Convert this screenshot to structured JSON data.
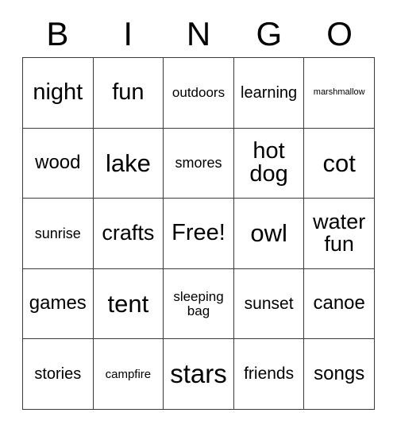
{
  "card": {
    "title": "BINGO",
    "header_letters": [
      "B",
      "I",
      "N",
      "G",
      "O"
    ],
    "free_space_label": "Free!",
    "text_color": "#000000",
    "border_color": "#3a3a3a",
    "background_color": "#ffffff",
    "rows": 5,
    "columns": 5,
    "cells": [
      [
        {
          "text": "night",
          "size": "fs-xxl"
        },
        {
          "text": "fun",
          "size": "fs-xxl"
        },
        {
          "text": "outdoors",
          "size": "fs-s"
        },
        {
          "text": "learning",
          "size": "fs-m"
        },
        {
          "text": "marshmallow",
          "size": "fs-xxs"
        }
      ],
      [
        {
          "text": "wood",
          "size": "fs-l"
        },
        {
          "text": "lake",
          "size": "fs-3xl"
        },
        {
          "text": "smores",
          "size": "fs-sm"
        },
        {
          "text": "hot dog",
          "size": "fs-xxl"
        },
        {
          "text": "cot",
          "size": "fs-3xl"
        }
      ],
      [
        {
          "text": "sunrise",
          "size": "fs-sm"
        },
        {
          "text": "crafts",
          "size": "fs-xl"
        },
        {
          "text": "Free!",
          "size": "fs-xxl"
        },
        {
          "text": "owl",
          "size": "fs-3xl"
        },
        {
          "text": "water fun",
          "size": "fs-xl"
        }
      ],
      [
        {
          "text": "games",
          "size": "fs-l"
        },
        {
          "text": "tent",
          "size": "fs-3xl"
        },
        {
          "text": "sleeping bag",
          "size": "fs-s"
        },
        {
          "text": "sunset",
          "size": "fs-ml"
        },
        {
          "text": "canoe",
          "size": "fs-l"
        }
      ],
      [
        {
          "text": "stories",
          "size": "fs-m"
        },
        {
          "text": "campfire",
          "size": "fs-xs"
        },
        {
          "text": "stars",
          "size": "fs-4xl"
        },
        {
          "text": "friends",
          "size": "fs-ml"
        },
        {
          "text": "songs",
          "size": "fs-l"
        }
      ]
    ]
  }
}
